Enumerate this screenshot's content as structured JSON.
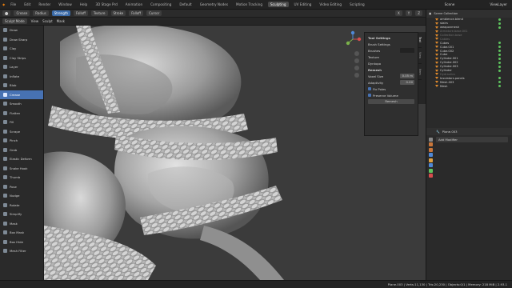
{
  "menubar": {
    "items": [
      "File",
      "Edit",
      "Render",
      "Window",
      "Help"
    ],
    "workspaces": [
      "3D Stage Prd",
      "Animation",
      "Compositing",
      "Default",
      "Geometry Nodes",
      "Motion Tracking",
      "Sculpting",
      "UV Editing",
      "Video Editing",
      "Scripting"
    ],
    "active_workspace": "Sculpting",
    "scene": "Scene",
    "view_layer": "ViewLayer"
  },
  "header": {
    "brush": "Crease",
    "radius_label": "Radius",
    "strength_label": "Strength",
    "direction": "Falloff",
    "texture": "Texture",
    "stroke": "Stroke",
    "falloff": "Falloff",
    "cursor": "Cursor",
    "options": [
      "X",
      "Y",
      "Z"
    ]
  },
  "tool_header": {
    "mode": "Sculpt Mode",
    "menus": [
      "View",
      "Sculpt",
      "Mask"
    ]
  },
  "toolbar": {
    "tools": [
      "Draw",
      "Draw Sharp",
      "Clay",
      "Clay Strips",
      "Layer",
      "Inflate",
      "Blob",
      "Crease",
      "Smooth",
      "Flatten",
      "Fill",
      "Scrape",
      "Pinch",
      "Grab",
      "Elastic Deform",
      "Snake Hook",
      "Thumb",
      "Pose",
      "Nudge",
      "Rotate",
      "Simplify",
      "Mask",
      "Box Mask",
      "Box Hide",
      "Mesh Filter"
    ],
    "active_index": 7
  },
  "npanel": {
    "title": "Tool Settings",
    "brush_header": "Brush Settings",
    "brushes_label": "Brushes",
    "texture_label": "Texture",
    "dyntopo_label": "Dyntopo",
    "remesh_title": "Remesh",
    "voxel_size_label": "Voxel Size",
    "voxel_size": "0.05 m",
    "adaptivity_label": "Adaptivity",
    "adaptivity": "0.00",
    "fix_poles": "Fix Poles",
    "preserve_volume": "Preserve Volume",
    "remesh_button": "Remesh",
    "tabs": [
      "Tool",
      "View",
      "Item"
    ]
  },
  "outliner": {
    "title": "Scene Collection",
    "items": [
      {
        "label": "ambience.blend",
        "dim": false
      },
      {
        "label": "stairs",
        "dim": false
      },
      {
        "label": "weaponmesh",
        "dim": false
      },
      {
        "label": "Armature.base.001",
        "dim": true
      },
      {
        "label": "Collection.base",
        "dim": true
      },
      {
        "label": "Cables",
        "dim": true
      },
      {
        "label": "Cubes",
        "dim": false
      },
      {
        "label": "Cube.001",
        "dim": false
      },
      {
        "label": "Cube.002",
        "dim": false
      },
      {
        "label": "Cube",
        "dim": false
      },
      {
        "label": "Cylinder.001",
        "dim": false
      },
      {
        "label": "Cylinder.002",
        "dim": false
      },
      {
        "label": "Cylinder.003",
        "dim": false
      },
      {
        "label": "Cylinder",
        "dim": false
      },
      {
        "label": "Hydraulics",
        "dim": true
      },
      {
        "label": "Insulators.panels",
        "dim": false
      },
      {
        "label": "Mesh.003",
        "dim": false
      },
      {
        "label": "Mesh",
        "dim": false
      }
    ]
  },
  "properties": {
    "object": "Plane.003",
    "add_modifier": "Add Modifier"
  },
  "statusbar": {
    "text": "Plane.003 | Verts:11,130 | Tris:20,230 | Objects:0/1 | Memory: 218 MiB | 2.93.1"
  }
}
